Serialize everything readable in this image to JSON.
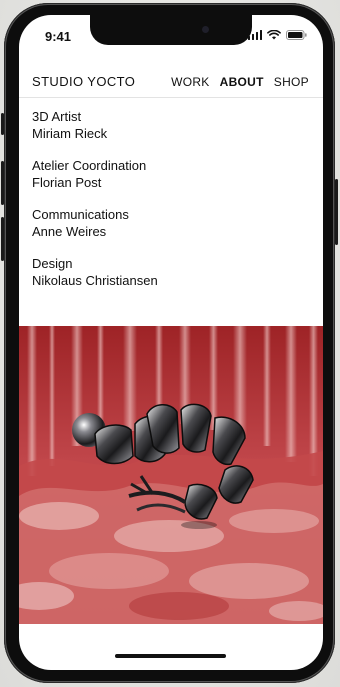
{
  "status_bar": {
    "time": "9:41"
  },
  "header": {
    "brand": "STUDIO YOCTO",
    "nav_items": [
      {
        "label": "WORK",
        "active": false
      },
      {
        "label": "ABOUT",
        "active": true
      },
      {
        "label": "SHOP",
        "active": false
      }
    ]
  },
  "credits": [
    {
      "role": "3D Artist",
      "name": "Miriam Rieck"
    },
    {
      "role": "Atelier Coordination",
      "name": "Florian Post"
    },
    {
      "role": "Communications",
      "name": "Anne Weires"
    },
    {
      "role": "Design",
      "name": "Nikolaus Christiansen"
    }
  ],
  "colors": {
    "artwork_red": "#b8393b",
    "artwork_light": "#efc4c0",
    "chrome_dark": "#1c1c1e"
  },
  "icons": [
    "cellular-signal-icon",
    "wifi-icon",
    "battery-icon"
  ]
}
